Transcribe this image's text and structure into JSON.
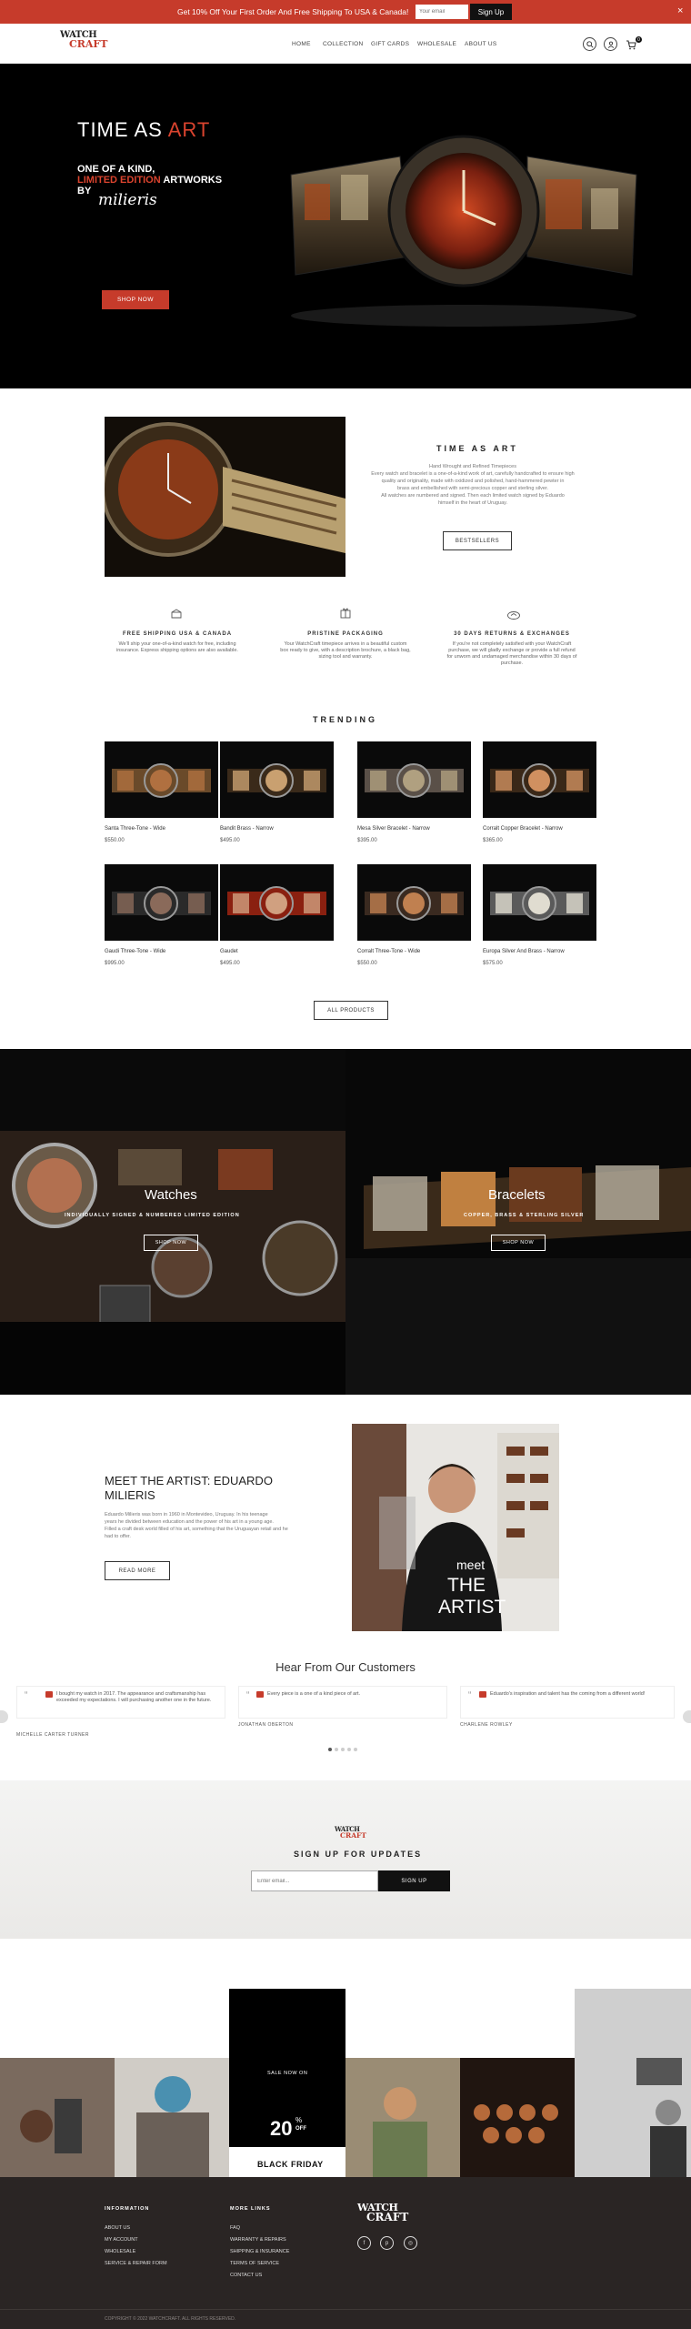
{
  "announcement": {
    "text": "Get 10% Off Your First Order And Free Shipping To USA & Canada!",
    "email_placeholder": "Your email",
    "signup_label": "Sign Up",
    "close_label": "×"
  },
  "header": {
    "logo_top": "WATCH",
    "logo_bottom": "CRAFT",
    "nav": [
      "HOME",
      "COLLECTION",
      "GIFT CARDS",
      "WHOLESALE",
      "ABOUT US"
    ],
    "cart_count": "0"
  },
  "hero": {
    "title_a": "TIME AS ",
    "title_b": "ART",
    "line1": "ONE OF A KIND,",
    "line2_red": "LIMITED EDITION",
    "line2_rest": " ARTWORKS",
    "line3": "BY",
    "signature": "milieris",
    "button": "SHOP NOW"
  },
  "intro": {
    "title": "TIME AS ART",
    "text": [
      "Hand Wrought and Refined Timepieces",
      "Every watch and bracelet is a one-of-a-kind work of art, carefully handcrafted to ensure high",
      "quality and originality, made with oxidized and polished, hand-hammered pewter in",
      "brass and embellished with semi-precious copper and sterling silver.",
      "All watches are numbered and signed. Then each limited watch signed by Eduardo",
      "himself in the heart of Uruguay."
    ],
    "button": "BESTSELLERS"
  },
  "features": [
    {
      "title": "FREE SHIPPING USA & CANADA",
      "desc": [
        "We'll ship your one-of-a-kind watch for free, including",
        "insurance. Express shipping options are also available."
      ]
    },
    {
      "title": "PRISTINE PACKAGING",
      "desc": [
        "Your WatchCraft timepiece arrives in a beautiful custom",
        "box ready to give, with a description brochure, a black bag,",
        "sizing tool and warranty."
      ]
    },
    {
      "title": "30 DAYS RETURNS & EXCHANGES",
      "desc": [
        "If you're not completely satisfied with your WatchCraft",
        "purchase, we will gladly exchange or provide a full refund",
        "for unworn and undamaged merchandise within 30 days of",
        "purchase."
      ]
    }
  ],
  "trending": {
    "title": "TRENDING",
    "products": [
      {
        "name": "Santa Three-Tone - Wide",
        "price": "$550.00"
      },
      {
        "name": "Bandit Brass - Narrow",
        "price": "$495.00"
      },
      {
        "name": "Mesa Silver Bracelet - Narrow",
        "price": "$395.00"
      },
      {
        "name": "Corralt Copper Bracelet - Narrow",
        "price": "$365.00"
      },
      {
        "name": "Gaudi Three-Tone - Wide",
        "price": "$995.00"
      },
      {
        "name": "Gaudet",
        "price": "$495.00"
      },
      {
        "name": "Corralt Three-Tone - Wide",
        "price": "$550.00"
      },
      {
        "name": "Europa Silver And Brass - Narrow",
        "price": "$575.00"
      }
    ],
    "button": "ALL PRODUCTS"
  },
  "categories": [
    {
      "title": "Watches",
      "sub": "INDIVIDUALLY SIGNED & NUMBERED LIMITED EDITION",
      "button": "SHOP NOW"
    },
    {
      "title": "Bracelets",
      "sub": "COPPER, BRASS & STERLING SILVER",
      "button": "SHOP NOW"
    }
  ],
  "artist": {
    "title_1": "MEET THE ARTIST: EDUARDO",
    "title_2": "MILIERIS",
    "text": [
      "Eduardo Milieris was born in 1960 in Montevideo, Uruguay. In his teenage",
      "years he divided between education and the power of his art in a young age.",
      "Filled a craft desk world filled of his art, something that the Uruguayan retail and he",
      "had to offer."
    ],
    "button": "READ MORE",
    "img_meet": "meet",
    "img_the": "THE",
    "img_artist": "ARTIST"
  },
  "testimonials": {
    "title": "Hear From Our Customers",
    "items": [
      {
        "text": [
          "I bought my watch in 2017. The appearance and craftsmanship has",
          "exceeded my expectations. I will purchasing another one in the future."
        ],
        "name": "MICHELLE CARTER TURNER"
      },
      {
        "text": [
          "Every piece is a one of a kind piece of art."
        ],
        "name": "JONATHAN OBERTON"
      },
      {
        "text": [
          "Eduardo's inspiration and talent has the coming from a different world!"
        ],
        "name": "CHARLENE ROWLEY"
      }
    ]
  },
  "newsletter": {
    "logo_top": "WATCH",
    "logo_bottom": "CRAFT",
    "title": "SIGN UP FOR UPDATES",
    "placeholder": "Enter email...",
    "button": "SIGN UP"
  },
  "promo": {
    "sale": "SALE NOW ON",
    "pct": "20",
    "pct_sup": "%",
    "off": "OFF",
    "black_friday": "BLACK FRIDAY"
  },
  "footer": {
    "info_title": "INFORMATION",
    "info_links": [
      "ABOUT US",
      "MY ACCOUNT",
      "WHOLESALE",
      "SERVICE & REPAIR FORM"
    ],
    "more_title": "MORE LINKS",
    "more_links": [
      "FAQ",
      "WARRANTY & REPAIRS",
      "SHIPPING & INSURANCE",
      "TERMS OF SERVICE",
      "CONTACT US"
    ],
    "logo_top": "WATCH",
    "logo_bottom": "CRAFT",
    "social": [
      "f",
      "p",
      "◎"
    ],
    "copyright": "COPYRIGHT © 2022 WATCHCRAFT. ALL RIGHTS RESERVED."
  },
  "colors": {
    "accent": "#c63b2b",
    "dark": "#000000",
    "footer": "#2a2524"
  }
}
